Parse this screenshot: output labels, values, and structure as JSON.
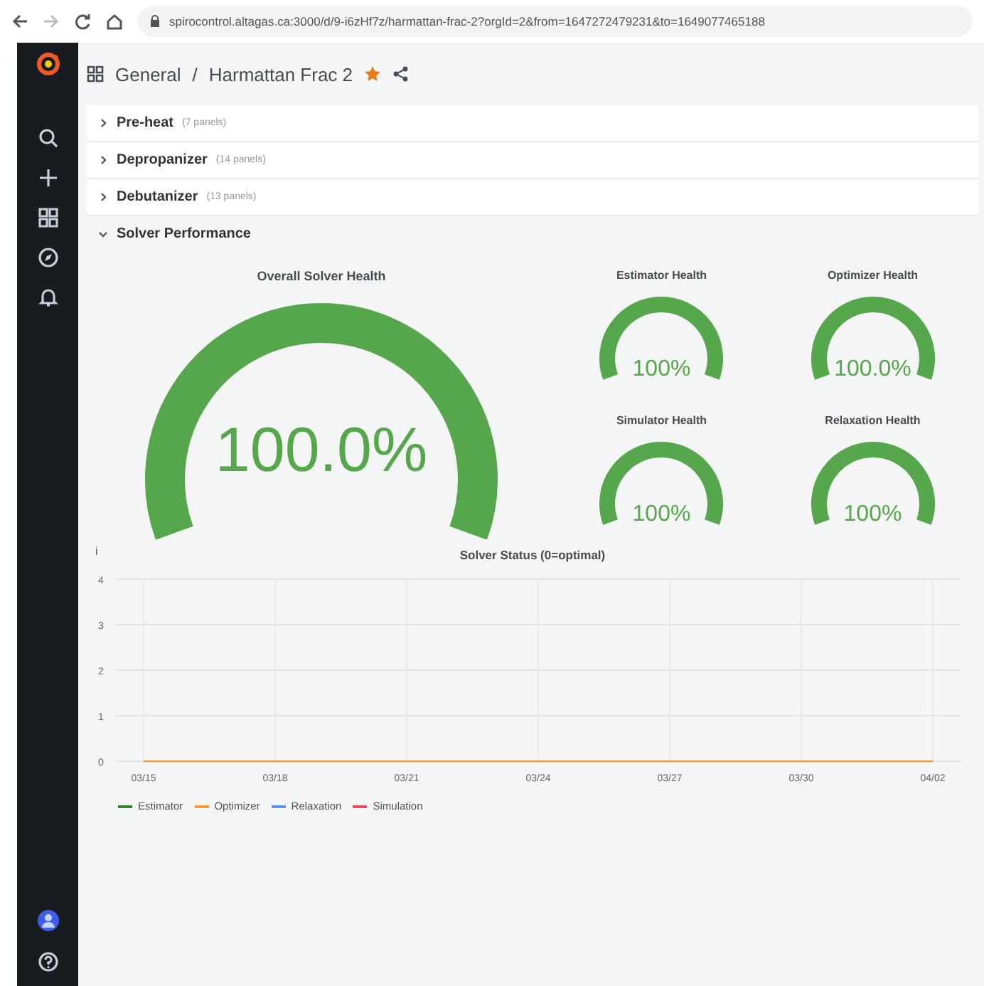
{
  "browser": {
    "url": "spirocontrol.altagas.ca:3000/d/9-i6zHf7z/harmattan-frac-2?orgId=2&from=1647272479231&to=1649077465188"
  },
  "breadcrumb": {
    "folder": "General",
    "separator": "/",
    "title": "Harmattan Frac 2",
    "starred": true
  },
  "rows": [
    {
      "title": "Pre-heat",
      "count": "(7 panels)",
      "expanded": false
    },
    {
      "title": "Depropanizer",
      "count": "(14 panels)",
      "expanded": false
    },
    {
      "title": "Debutanizer",
      "count": "(13 panels)",
      "expanded": false
    },
    {
      "title": "Solver Performance",
      "expanded": true
    }
  ],
  "gauges": [
    {
      "kind": "large",
      "title": "Overall Solver Health",
      "value": "100.0%",
      "level": 1
    },
    {
      "kind": "small",
      "title": "Estimator Health",
      "value": "100%",
      "level": 1
    },
    {
      "kind": "small",
      "title": "Optimizer Health",
      "value": "100.0%",
      "level": 1
    },
    {
      "kind": "small",
      "title": "Simulator Health",
      "value": "100%",
      "level": 1
    },
    {
      "kind": "small",
      "title": "Relaxation Health",
      "value": "100%",
      "level": 1
    }
  ],
  "status_panel": {
    "info": "i",
    "chart_data": {
      "type": "line",
      "grid": true,
      "title": "Solver Status (0=optimal)",
      "categories": [
        "03/15",
        "03/18",
        "03/21",
        "03/24",
        "03/27",
        "03/30",
        "04/02"
      ],
      "ylim": [
        0,
        4
      ],
      "yticks": [
        0,
        1,
        2,
        3,
        4
      ],
      "series": [
        {
          "name": "Estimator",
          "color": "#37872d",
          "values": [
            null,
            null,
            null,
            null,
            null,
            null,
            null
          ]
        },
        {
          "name": "Optimizer",
          "color": "#ff9830",
          "values": [
            0,
            0,
            0,
            0,
            0,
            0,
            0
          ]
        },
        {
          "name": "Relaxation",
          "color": "#5794f2",
          "values": [
            null,
            null,
            null,
            null,
            null,
            null,
            null
          ]
        },
        {
          "name": "Simulation",
          "color": "#f2495c",
          "values": [
            null,
            null,
            null,
            null,
            null,
            null,
            null
          ]
        }
      ]
    }
  }
}
